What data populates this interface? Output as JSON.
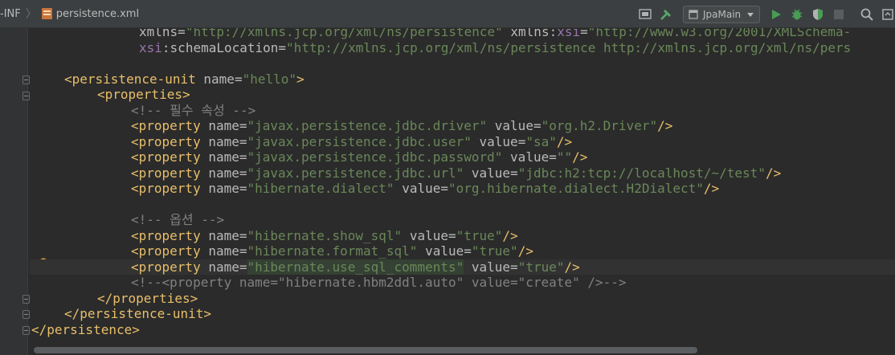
{
  "breadcrumb": {
    "parent": "-INF",
    "separator": "〉",
    "file": "persistence.xml"
  },
  "toolbar": {
    "run_config": "JpaMain",
    "icons": [
      "build-icon",
      "hammer-icon",
      "run-icon",
      "debug-icon",
      "coverage-icon",
      "stop-icon",
      "search-icon",
      "ide-update-icon"
    ]
  },
  "colors": {
    "tag": "#e8bf6a",
    "attr": "#bababa",
    "ns": "#9876aa",
    "value": "#6a8759",
    "comment": "#808080",
    "background": "#2b2b2b"
  },
  "code": {
    "l1": {
      "a": "xmlns",
      "b": "\"http://xmlns.jcp.org/xml/ns/persistence\"",
      "c": "xmlns",
      "d": "xsi",
      "e": "\"http://www.w3.org/2001/XMLSchema-"
    },
    "l2": {
      "a": "xsi",
      "b": "schemaLocation",
      "c": "\"http://xmlns.jcp.org/xml/ns/persistence http://xmlns.jcp.org/xml/ns/pers"
    },
    "l4": {
      "open": "<persistence-unit",
      "attr": "name",
      "val": "\"hello\"",
      "close": ">"
    },
    "l5": {
      "tag": "<properties>"
    },
    "l6": {
      "comment": "<!-- 필수 속성 -->"
    },
    "props": [
      {
        "name": "\"javax.persistence.jdbc.driver\"",
        "value": "\"org.h2.Driver\""
      },
      {
        "name": "\"javax.persistence.jdbc.user\"",
        "value": "\"sa\""
      },
      {
        "name": "\"javax.persistence.jdbc.password\"",
        "value": "\"\""
      },
      {
        "name": "\"javax.persistence.jdbc.url\"",
        "value": "\"jdbc:h2:tcp://localhost/~/test\""
      },
      {
        "name": "\"hibernate.dialect\"",
        "value": "\"org.hibernate.dialect.H2Dialect\""
      }
    ],
    "l13": {
      "comment": "<!-- 옵션 -->"
    },
    "props2": [
      {
        "name": "\"hibernate.show_sql\"",
        "value": "\"true\""
      },
      {
        "name": "\"hibernate.format_sql\"",
        "value": "\"true\""
      },
      {
        "name": "\"hibernate.use_sql_comments\"",
        "value": "\"true\""
      }
    ],
    "prop_tag": "<property",
    "prop_name_attr": "name",
    "prop_value_attr": "value",
    "prop_end": "/>",
    "l17": {
      "comment": "<!--<property name=\"hibernate.hbm2ddl.auto\" value=\"create\" />-->"
    },
    "l18": {
      "tag": "</properties>"
    },
    "l19": {
      "tag": "</persistence-unit>"
    },
    "l20": {
      "tag": "</persistence>"
    }
  }
}
